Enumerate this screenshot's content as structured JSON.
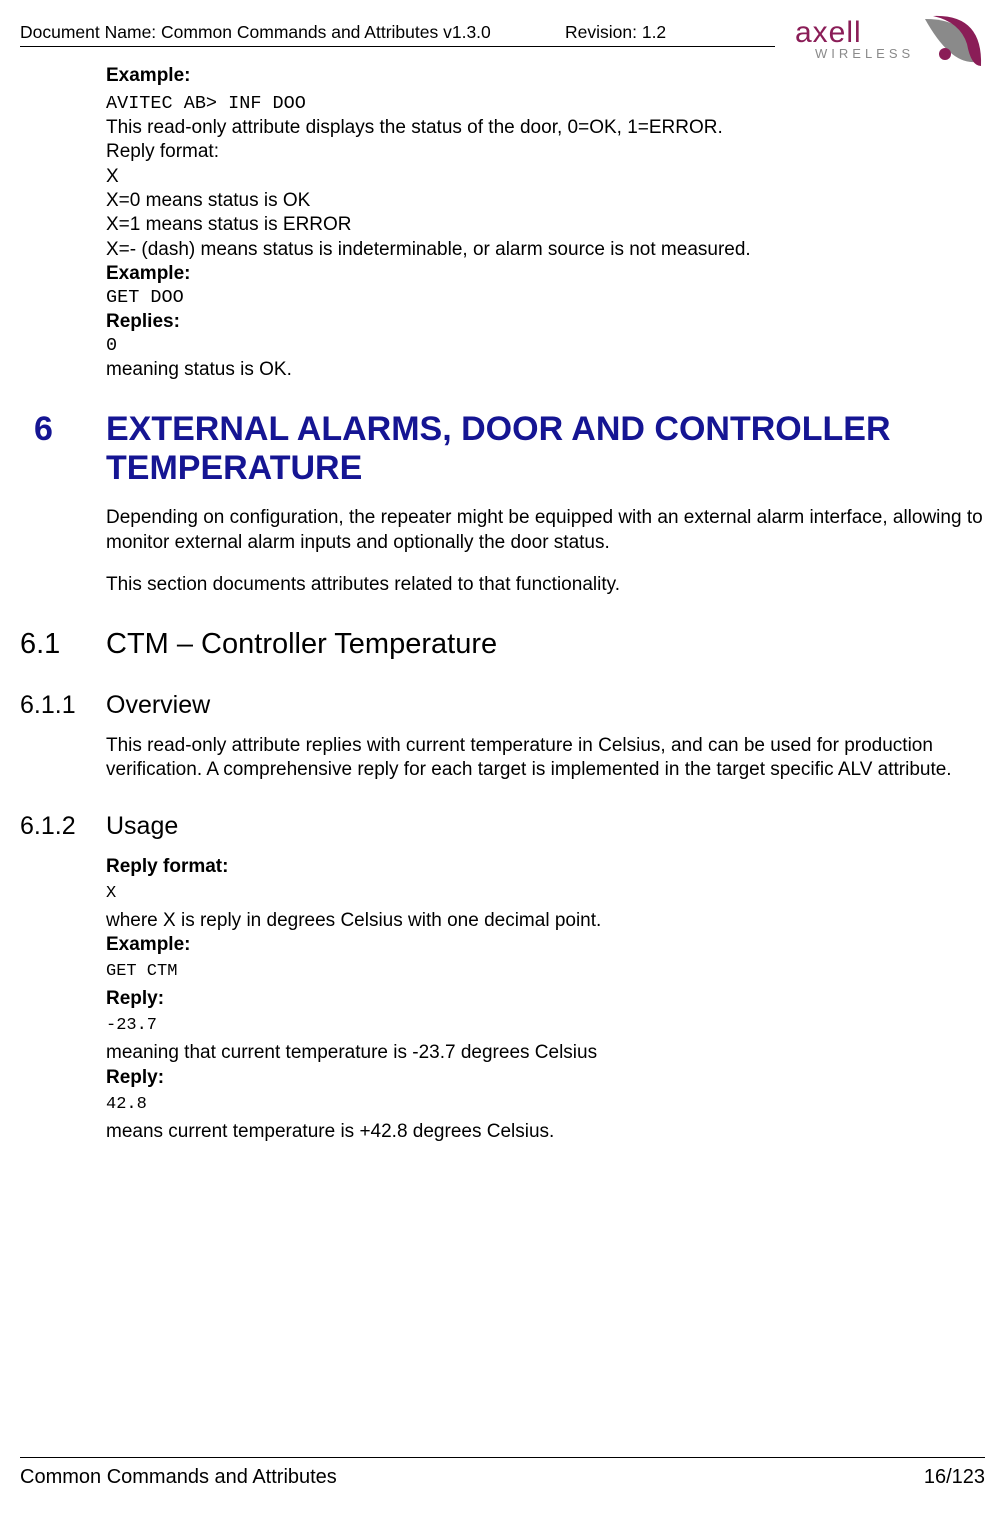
{
  "header": {
    "doc_name": "Document Name: Common Commands and Attributes v1.3.0",
    "revision": "Revision: 1.2",
    "logo_main": "axell",
    "logo_sub": "WIRELESS"
  },
  "body": {
    "example_label_1": "Example:",
    "cmd1": "AVITEC AB> INF DOO",
    "desc1": "This read-only attribute displays the status of the door, 0=OK, 1=ERROR.",
    "reply_format_label": "Reply format:",
    "x": "X",
    "x0": "X=0 means status is OK",
    "x1": "X=1 means status is ERROR",
    "xdash": "X=- (dash) means status is indeterminable, or alarm source is not measured.",
    "example_label_2": "Example:",
    "cmd2": "GET DOO",
    "replies_label": "Replies:",
    "reply0": "0",
    "meaning_ok": "meaning status is OK."
  },
  "section6": {
    "num": "6",
    "title": "EXTERNAL ALARMS, DOOR AND CONTROLLER TEMPERATURE",
    "p1": "Depending on configuration, the repeater might be equipped with an external alarm interface, allowing to monitor external alarm inputs and optionally the door status.",
    "p2": "This section documents attributes related to that functionality."
  },
  "section61": {
    "num": "6.1",
    "title": "CTM – Controller Temperature"
  },
  "section611": {
    "num": "6.1.1",
    "title": "Overview",
    "p1": "This read-only attribute replies with current temperature in Celsius, and can be used for production verification. A comprehensive reply for each target is implemented in the target specific ALV attribute."
  },
  "section612": {
    "num": "6.1.2",
    "title": "Usage",
    "reply_format_label": "Reply format:",
    "x": "X",
    "desc_x": "where X is reply in degrees Celsius with one decimal point.",
    "example_label": "Example:",
    "cmd": "GET CTM",
    "reply_label_1": "Reply:",
    "reply_val_1": "-23.7",
    "meaning_1": "meaning that current temperature is -23.7 degrees Celsius",
    "reply_label_2": "Reply:",
    "reply_val_2": "42.8",
    "meaning_2": "means current temperature is +42.8 degrees Celsius."
  },
  "footer": {
    "title": "Common Commands and Attributes",
    "page": "16/123"
  }
}
